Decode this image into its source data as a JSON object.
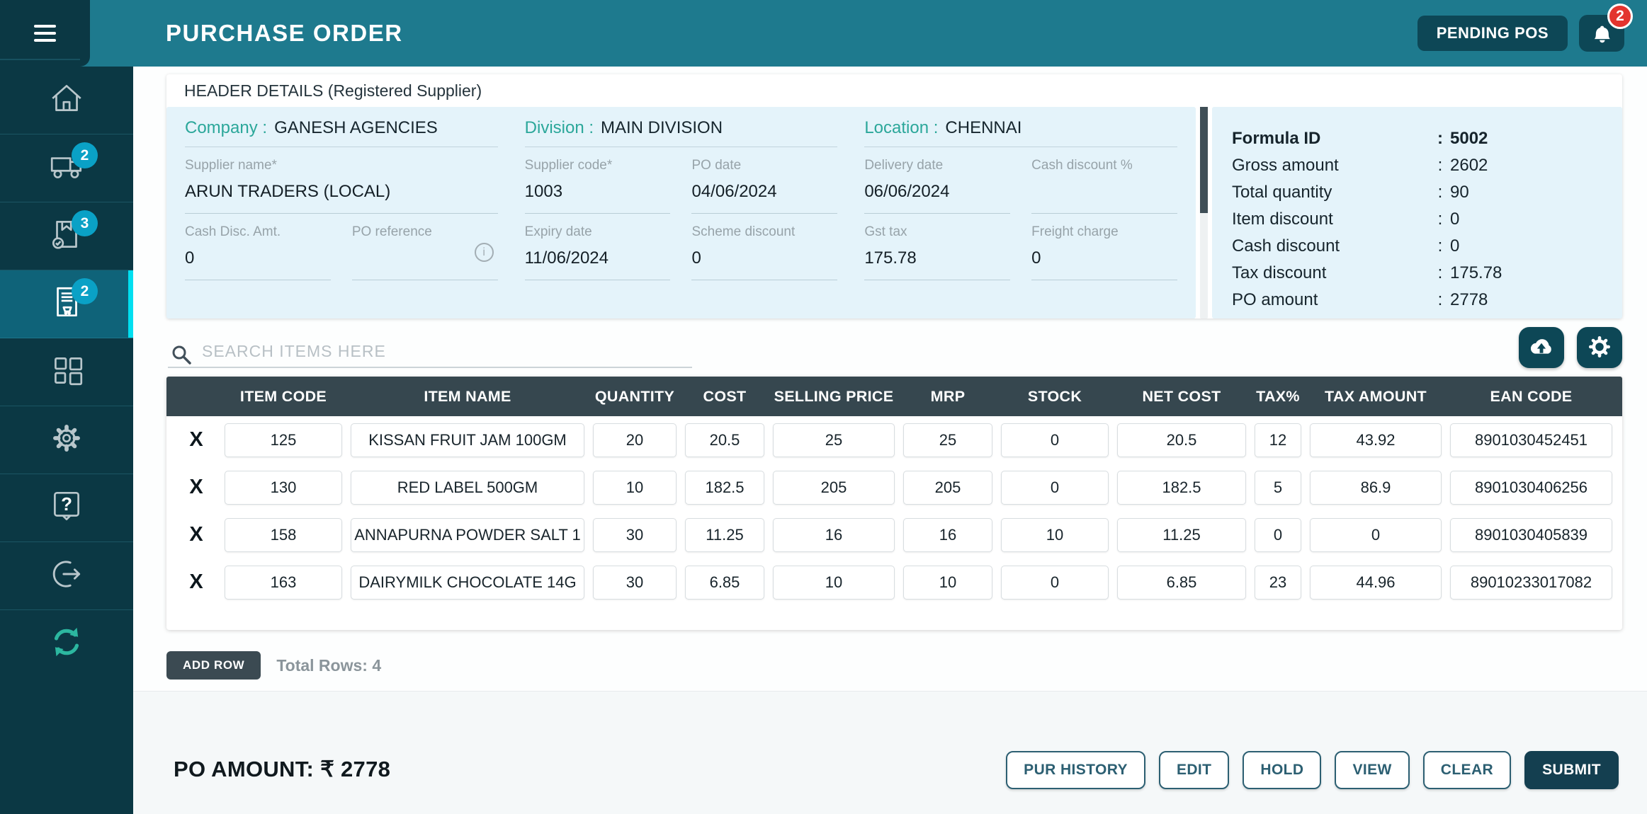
{
  "topbar": {
    "title": "PURCHASE ORDER",
    "pending_pos": "PENDING POS",
    "notification_count": "2"
  },
  "sidebar": {
    "truck_badge": "2",
    "grn_badge": "3",
    "po_badge": "2"
  },
  "header_card": {
    "title": "HEADER DETAILS (Registered Supplier)",
    "groups": [
      {
        "label": "Company :",
        "value": "GANESH AGENCIES"
      },
      {
        "label": "Division :",
        "value": "MAIN DIVISION"
      },
      {
        "label": "Location :",
        "value": "CHENNAI"
      }
    ],
    "fields": {
      "supplier_name": {
        "label": "Supplier name*",
        "value": "ARUN TRADERS (LOCAL)"
      },
      "supplier_code": {
        "label": "Supplier code*",
        "value": "1003"
      },
      "po_date": {
        "label": "PO date",
        "value": "04/06/2024"
      },
      "delivery_date": {
        "label": "Delivery date",
        "value": "06/06/2024"
      },
      "cash_discount_pct": {
        "label": "Cash discount %",
        "value": ""
      },
      "cash_disc_amt": {
        "label": "Cash Disc. Amt.",
        "value": "0"
      },
      "po_reference": {
        "label": "PO reference",
        "value": ""
      },
      "expiry_date": {
        "label": "Expiry date",
        "value": "11/06/2024"
      },
      "scheme_discount": {
        "label": "Scheme discount",
        "value": "0"
      },
      "gst_tax": {
        "label": "Gst tax",
        "value": "175.78"
      },
      "freight_charge": {
        "label": "Freight charge",
        "value": "0"
      }
    },
    "info_symbol": "i"
  },
  "formula": {
    "separator": ":",
    "rows": [
      {
        "label": "Formula ID",
        "value": "5002"
      },
      {
        "label": "Gross amount",
        "value": "2602"
      },
      {
        "label": "Total quantity",
        "value": "90"
      },
      {
        "label": "Item discount",
        "value": "0"
      },
      {
        "label": "Cash discount",
        "value": "0"
      },
      {
        "label": "Tax discount",
        "value": "175.78"
      },
      {
        "label": "PO amount",
        "value": "2778"
      }
    ]
  },
  "search": {
    "placeholder": "SEARCH ITEMS HERE"
  },
  "table": {
    "headers": [
      "ITEM CODE",
      "ITEM NAME",
      "QUANTITY",
      "COST",
      "SELLING PRICE",
      "MRP",
      "STOCK",
      "NET COST",
      "TAX%",
      "TAX AMOUNT",
      "EAN CODE"
    ],
    "delete_symbol": "X",
    "rows": [
      {
        "item_code": "125",
        "item_name": "KISSAN FRUIT JAM 100GM",
        "quantity": "20",
        "cost": "20.5",
        "selling_price": "25",
        "mrp": "25",
        "stock": "0",
        "net_cost": "20.5",
        "tax_pct": "12",
        "tax_amount": "43.92",
        "ean_code": "8901030452451"
      },
      {
        "item_code": "130",
        "item_name": "RED LABEL 500GM",
        "quantity": "10",
        "cost": "182.5",
        "selling_price": "205",
        "mrp": "205",
        "stock": "0",
        "net_cost": "182.5",
        "tax_pct": "5",
        "tax_amount": "86.9",
        "ean_code": "8901030406256"
      },
      {
        "item_code": "158",
        "item_name": "ANNAPURNA POWDER SALT 1",
        "quantity": "30",
        "cost": "11.25",
        "selling_price": "16",
        "mrp": "16",
        "stock": "10",
        "net_cost": "11.25",
        "tax_pct": "0",
        "tax_amount": "0",
        "ean_code": "8901030405839"
      },
      {
        "item_code": "163",
        "item_name": "DAIRYMILK CHOCOLATE 14G",
        "quantity": "30",
        "cost": "6.85",
        "selling_price": "10",
        "mrp": "10",
        "stock": "0",
        "net_cost": "6.85",
        "tax_pct": "23",
        "tax_amount": "44.96",
        "ean_code": "89010233017082"
      }
    ],
    "add_row": "ADD ROW",
    "total_rows": "Total Rows: 4"
  },
  "footer": {
    "po_amount": "PO AMOUNT: ₹ 2778",
    "buttons": [
      "PUR HISTORY",
      "EDIT",
      "HOLD",
      "VIEW",
      "CLEAR",
      "SUBMIT"
    ]
  },
  "colors": {
    "topbar": "#1e7a8e",
    "sidebar": "#0b3844",
    "active_accent": "#00dff0",
    "badge": "#0aa1c6",
    "alert": "#e3342f",
    "table_header": "#36474f",
    "panel": "#e4f3fa",
    "teal_label": "#2ba79a",
    "dark_button": "#0d4756"
  }
}
